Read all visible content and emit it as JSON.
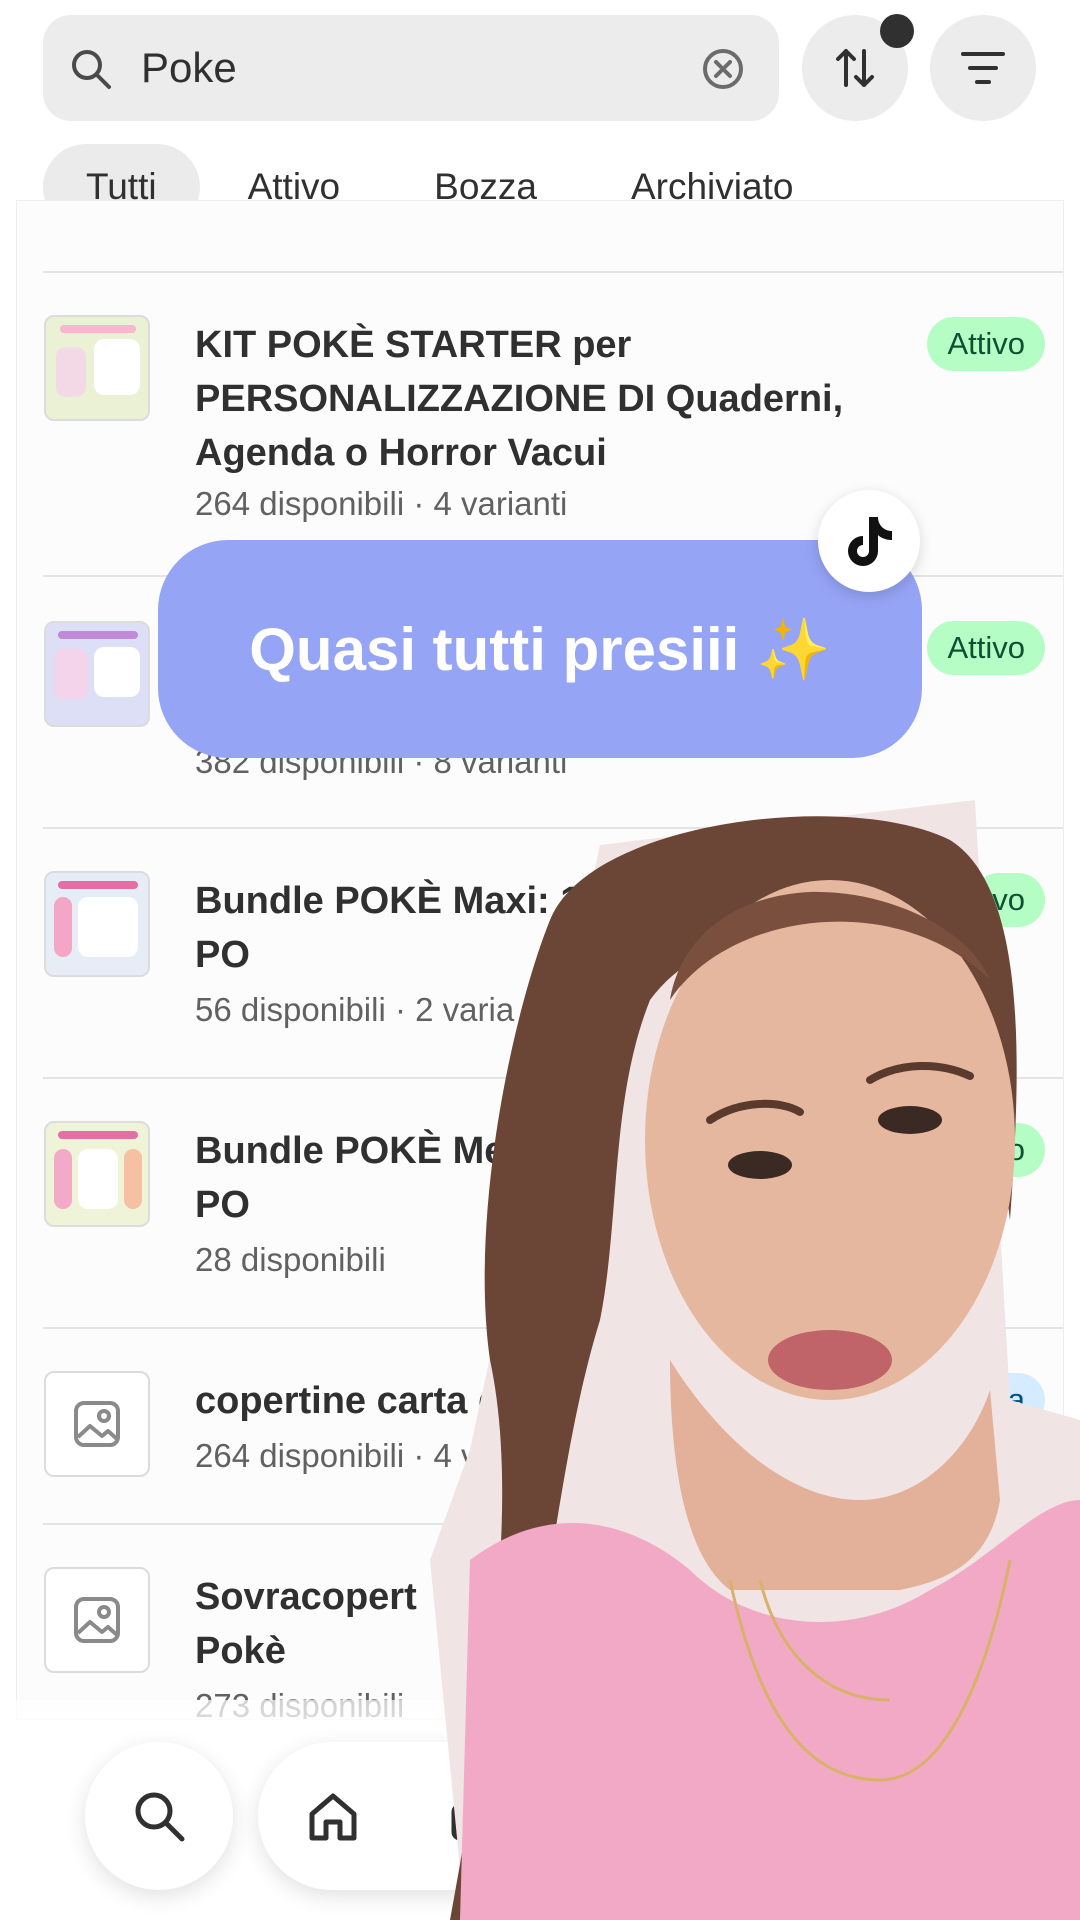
{
  "search": {
    "query": "Poke",
    "icon": "search-icon",
    "clear_icon": "clear-circle-x-icon"
  },
  "toolbar": {
    "sort_icon": "sort-arrows-icon",
    "filter_icon": "filter-lines-icon"
  },
  "tabs": [
    {
      "label": "Tutti",
      "active": true
    },
    {
      "label": "Attivo",
      "active": false
    },
    {
      "label": "Bozza",
      "active": false
    },
    {
      "label": "Archiviato",
      "active": false
    }
  ],
  "products": [
    {
      "title": "KIT POKÈ STARTER per PERSONALIZZAZIONE DI Quaderni, Agenda o Horror Vacui",
      "meta": "264 disponibili · 4 varianti",
      "status": "Attivo"
    },
    {
      "title": "",
      "meta": "382 disponibili · 8 varianti",
      "status": "Attivo"
    },
    {
      "title": "Bundle POKÈ Maxi: 1 A5 + TUTTI I KIT PO",
      "meta": "56 disponibili · 2 varia",
      "status": "vo"
    },
    {
      "title": "Bundle POKÈ Mega A5 + TUTTI I KIT PO",
      "meta": "28 disponibili",
      "status": "o"
    },
    {
      "title": "copertine carta quaderni",
      "meta": "264 disponibili · 4 varianti",
      "status": "za"
    },
    {
      "title": "Sovracopert Pokè",
      "meta": "273 disponibili",
      "status": ""
    }
  ],
  "sticker": {
    "text": "Quasi tutti presiii ✨"
  },
  "nav": {
    "search_icon": "search-icon",
    "home_icon": "home-icon",
    "orders_icon": "orders-icon"
  },
  "colors": {
    "badge_active_bg": "#b4fec5",
    "badge_draft_bg": "#d5ebff",
    "sticker_bg": "#95a4f5",
    "control_bg": "#ececec"
  }
}
